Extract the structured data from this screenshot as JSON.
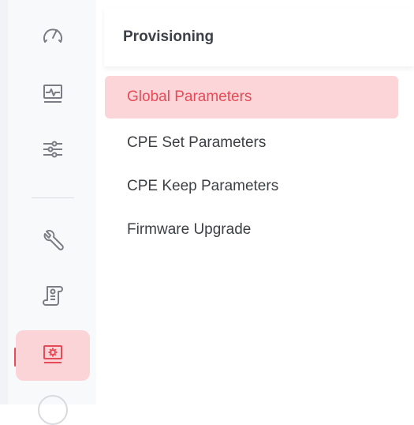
{
  "sidebar": {
    "icons": [
      "gauge-icon",
      "monitor-pulse-icon",
      "sliders-icon",
      "wrench-icon",
      "scroll-document-icon",
      "provisioning-gear-monitor-icon"
    ],
    "active_index": 5
  },
  "panel": {
    "title": "Provisioning",
    "items": [
      {
        "label": "Global Parameters",
        "active": true
      },
      {
        "label": "CPE Set Parameters",
        "active": false
      },
      {
        "label": "CPE Keep Parameters",
        "active": false
      },
      {
        "label": "Firmware Upgrade",
        "active": false
      }
    ]
  },
  "colors": {
    "accent": "#e64a57",
    "active_bg": "#fcd5d8",
    "icon": "#7a7d84",
    "text": "#3d3f44"
  }
}
